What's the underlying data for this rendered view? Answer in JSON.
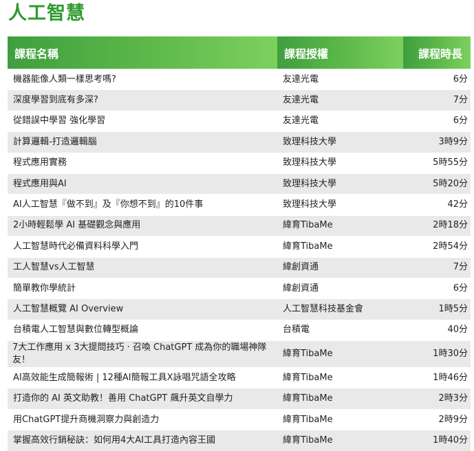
{
  "page": {
    "title": "人工智慧"
  },
  "table": {
    "headers": {
      "name": "課程名稱",
      "provider": "課程授權",
      "hours": "課程時長"
    },
    "rows": [
      {
        "name": "機器能像人類一樣思考嗎?",
        "provider": "友達光電",
        "hours": "6分"
      },
      {
        "name": "深度學習到底有多深?",
        "provider": "友達光電",
        "hours": "7分"
      },
      {
        "name": "從錯誤中學習 強化學習",
        "provider": "友達光電",
        "hours": "6分"
      },
      {
        "name": "計算邏輯-打造邏輯腦",
        "provider": "致理科技大學",
        "hours": "3時9分"
      },
      {
        "name": "程式應用實務",
        "provider": "致理科技大學",
        "hours": "5時55分"
      },
      {
        "name": "程式應用與AI",
        "provider": "致理科技大學",
        "hours": "5時20分"
      },
      {
        "name": "AI人工智慧『做不到』及『你想不到』的10件事",
        "provider": "致理科技大學",
        "hours": "42分"
      },
      {
        "name": "2小時輕鬆學 AI 基礎觀念與應用",
        "provider": "緯育TibaMe",
        "hours": "2時18分"
      },
      {
        "name": "人工智慧時代必備資料科學入門",
        "provider": "緯育TibaMe",
        "hours": "2時54分"
      },
      {
        "name": "工人智慧vs人工智慧",
        "provider": "緯創資通",
        "hours": "7分"
      },
      {
        "name": "簡單教你學統計",
        "provider": "緯創資通",
        "hours": "6分"
      },
      {
        "name": "人工智慧概覽 AI Overview",
        "provider": "人工智慧科技基金會",
        "hours": "1時5分"
      },
      {
        "name": "台積電人工智慧與數位轉型概論",
        "provider": "台積電",
        "hours": "40分"
      },
      {
        "name": "7大工作應用 x 3大提問技巧 · 召喚 ChatGPT 成為你的職場神隊友！",
        "provider": "緯育TibaMe",
        "hours": "1時30分"
      },
      {
        "name": "AI高效能生成簡報術 | 12種AI簡報工具X詠唱咒語全攻略",
        "provider": "緯育TibaMe",
        "hours": "1時46分"
      },
      {
        "name": "打造你的 AI 英文助教！善用 ChatGPT 飆升英文自學力",
        "provider": "緯育TibaMe",
        "hours": "2時3分"
      },
      {
        "name": "用ChatGPT提升商機洞察力與創造力",
        "provider": "緯育TibaMe",
        "hours": "2時9分"
      },
      {
        "name": "掌握高效行銷秘訣：如何用4大AI工具打造內容王國",
        "provider": "緯育TibaMe",
        "hours": "1時40分"
      }
    ]
  }
}
